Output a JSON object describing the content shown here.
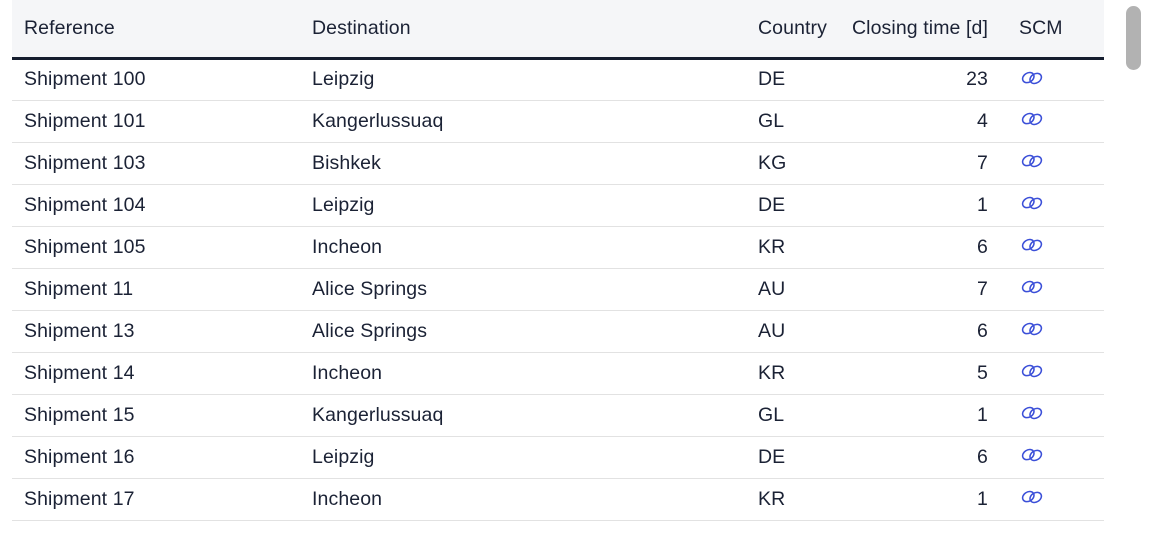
{
  "table": {
    "columns": [
      {
        "key": "reference",
        "label": "Reference",
        "align": "left"
      },
      {
        "key": "destination",
        "label": "Destination",
        "align": "left"
      },
      {
        "key": "country",
        "label": "Country",
        "align": "left"
      },
      {
        "key": "closing_time",
        "label": "Closing time [d]",
        "align": "right"
      },
      {
        "key": "scm",
        "label": "SCM",
        "align": "left"
      }
    ],
    "rows": [
      {
        "reference": "Shipment 100",
        "destination": "Leipzig",
        "country": "DE",
        "closing_time": "23",
        "scm_icon": "chain-link-icon"
      },
      {
        "reference": "Shipment 101",
        "destination": "Kangerlussuaq",
        "country": "GL",
        "closing_time": "4",
        "scm_icon": "chain-link-icon"
      },
      {
        "reference": "Shipment 103",
        "destination": "Bishkek",
        "country": "KG",
        "closing_time": "7",
        "scm_icon": "chain-link-icon"
      },
      {
        "reference": "Shipment 104",
        "destination": "Leipzig",
        "country": "DE",
        "closing_time": "1",
        "scm_icon": "chain-link-icon"
      },
      {
        "reference": "Shipment 105",
        "destination": "Incheon",
        "country": "KR",
        "closing_time": "6",
        "scm_icon": "chain-link-icon"
      },
      {
        "reference": "Shipment 11",
        "destination": "Alice Springs",
        "country": "AU",
        "closing_time": "7",
        "scm_icon": "chain-link-icon"
      },
      {
        "reference": "Shipment 13",
        "destination": "Alice Springs",
        "country": "AU",
        "closing_time": "6",
        "scm_icon": "chain-link-icon"
      },
      {
        "reference": "Shipment 14",
        "destination": "Incheon",
        "country": "KR",
        "closing_time": "5",
        "scm_icon": "chain-link-icon"
      },
      {
        "reference": "Shipment 15",
        "destination": "Kangerlussuaq",
        "country": "GL",
        "closing_time": "1",
        "scm_icon": "chain-link-icon"
      },
      {
        "reference": "Shipment 16",
        "destination": "Leipzig",
        "country": "DE",
        "closing_time": "6",
        "scm_icon": "chain-link-icon"
      },
      {
        "reference": "Shipment 17",
        "destination": "Incheon",
        "country": "KR",
        "closing_time": "1",
        "scm_icon": "chain-link-icon"
      }
    ]
  },
  "scrollbar": {
    "orientation": "vertical",
    "thumb_color": "#b2b2b2"
  },
  "colors": {
    "header_background": "#f5f6f8",
    "header_rule": "#151d2e",
    "row_divider": "#e2e2e2",
    "text": "#1b2235",
    "link_icon": "#3b4fd8",
    "page_background": "#ffffff"
  }
}
